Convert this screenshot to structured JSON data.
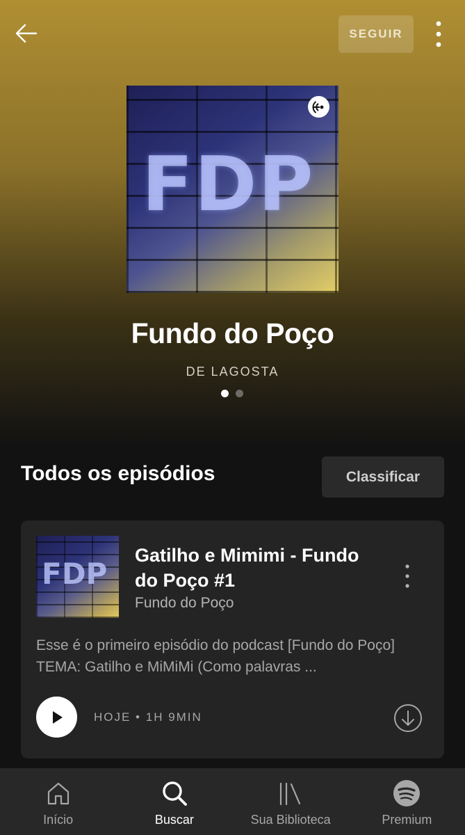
{
  "header": {
    "follow_label": "SEGUIR"
  },
  "podcast": {
    "title": "Fundo do Poço",
    "author": "DE LAGOSTA",
    "cover_art_text": "FDP",
    "pager": {
      "count": 2,
      "active": 1
    }
  },
  "episodes_section": {
    "title": "Todos os episódios",
    "sort_label": "Classificar"
  },
  "episode": {
    "title": "Gatilho e Mimimi - Fundo do Poço #1",
    "show": "Fundo do Poço",
    "description": "Esse é o primeiro episódio do podcast [Fundo do Poço]  TEMA: Gatilho e MiMiMi (Como palavras ...",
    "meta": "HOJE • 1H 9MIN",
    "thumb_art_text": "FDP"
  },
  "bottom_nav": {
    "items": [
      {
        "label": "Início",
        "icon": "home-icon"
      },
      {
        "label": "Buscar",
        "icon": "search-icon",
        "active": true
      },
      {
        "label": "Sua Biblioteca",
        "icon": "library-icon"
      },
      {
        "label": "Premium",
        "icon": "spotify-icon"
      }
    ]
  },
  "colors": {
    "hero_gradient_top": "#b08f33",
    "background": "#121212",
    "card": "#242424",
    "nav": "#282828"
  }
}
